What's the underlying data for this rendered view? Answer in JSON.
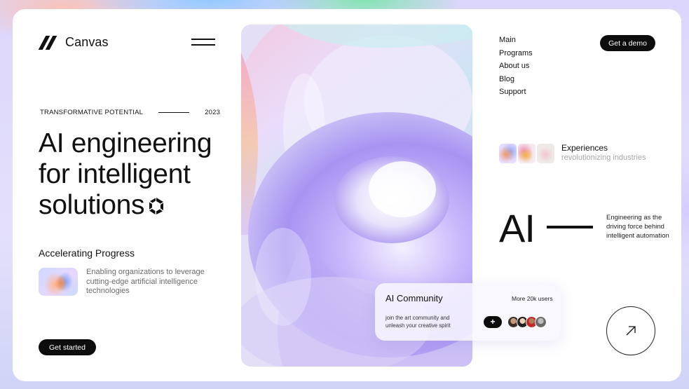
{
  "brand": {
    "name": "Canvas",
    "logo_icon": "double-slash-logo-icon"
  },
  "menu": {
    "icon": "hamburger-menu-icon"
  },
  "hero": {
    "eyebrow": "TRANSFORMATIVE POTENTIAL",
    "year": "2023",
    "headline_lines": [
      "AI engineering",
      "for intelligent",
      "solutions"
    ],
    "headline_icon": "spinning-hexagon-icon"
  },
  "progress": {
    "title": "Accelerating Progress",
    "description": "Enabling organizations to leverage cutting-edge artificial intelligence technologies"
  },
  "cta": {
    "get_started": "Get started",
    "get_demo": "Get a demo"
  },
  "nav": {
    "items": [
      "Main",
      "Programs",
      "About us",
      "Blog",
      "Support"
    ]
  },
  "experiences": {
    "title": "Experiences",
    "subtitle": "revolutionizing industries"
  },
  "ai_block": {
    "big_text": "AI",
    "description": "Engineering as the driving force behind intelligent automation"
  },
  "community": {
    "title": "AI Community",
    "users": "More 20k users",
    "description": "join the art community and unleash your creative spirit",
    "join_label": "+"
  },
  "arrow_button": {
    "icon": "arrow-up-right-icon"
  },
  "colors": {
    "accent_dark": "#0d0d0d",
    "card_bg": "#ffffff",
    "hero_purple": "#b8a7f5"
  }
}
